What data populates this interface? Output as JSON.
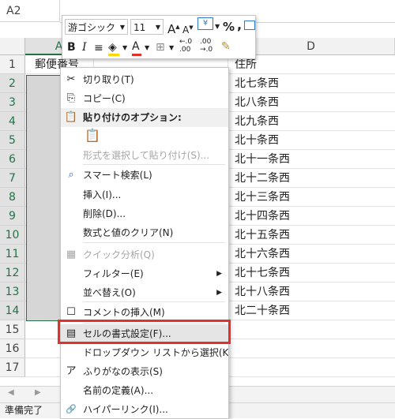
{
  "name_box": "A2",
  "columns": {
    "a": "A",
    "d": "D"
  },
  "rows": [
    "1",
    "2",
    "3",
    "4",
    "5",
    "6",
    "7",
    "8",
    "9",
    "10",
    "11",
    "12",
    "13",
    "14",
    "15",
    "16",
    "17"
  ],
  "header_row": {
    "a1": "郵便番号",
    "c1": "住所"
  },
  "addresses": [
    "北七条西",
    "北八条西",
    "北九条西",
    "北十条西",
    "北十一条西",
    "北十二条西",
    "北十三条西",
    "北十四条西",
    "北十五条西",
    "北十六条西",
    "北十七条西",
    "北十八条西",
    "北二十条西"
  ],
  "mini_toolbar": {
    "font_name": "游ゴシック",
    "font_size": "11",
    "grow_font": "A",
    "shrink_font": "A",
    "currency": "¥",
    "percent": "%",
    "comma": ",",
    "bold": "B",
    "italic": "I",
    "font_color_letter": "A",
    "increase_decimal": ".00",
    "decrease_decimal": ".0",
    "colors": {
      "fill": "#ffd800",
      "font": "#e0312a"
    }
  },
  "context_menu": [
    {
      "label": "切り取り(T)",
      "icon": "scissors-icon",
      "disabled": false
    },
    {
      "label": "コピー(C)",
      "icon": "copy-icon",
      "disabled": false
    },
    {
      "label": "貼り付けのオプション:",
      "icon": "paste-icon",
      "disabled": false,
      "header": true
    },
    {
      "label": "形式を選択して貼り付け(S)...",
      "icon": "",
      "disabled": true
    },
    {
      "label": "スマート検索(L)",
      "icon": "smart-lookup-icon",
      "disabled": false
    },
    {
      "label": "挿入(I)...",
      "icon": "",
      "disabled": false
    },
    {
      "label": "削除(D)...",
      "icon": "",
      "disabled": false
    },
    {
      "label": "数式と値のクリア(N)",
      "icon": "",
      "disabled": false
    },
    {
      "label": "クイック分析(Q)",
      "icon": "quick-analysis-icon",
      "disabled": true
    },
    {
      "label": "フィルター(E)",
      "icon": "",
      "disabled": false,
      "submenu": true
    },
    {
      "label": "並べ替え(O)",
      "icon": "",
      "disabled": false,
      "submenu": true
    },
    {
      "label": "コメントの挿入(M)",
      "icon": "comment-icon",
      "disabled": false
    },
    {
      "label": "セルの書式設定(F)...",
      "icon": "format-cells-icon",
      "disabled": false,
      "highlighted": true
    },
    {
      "label": "ドロップダウン リストから選択(K)...",
      "icon": "",
      "disabled": false
    },
    {
      "label": "ふりがなの表示(S)",
      "icon": "furigana-icon",
      "disabled": false
    },
    {
      "label": "名前の定義(A)...",
      "icon": "",
      "disabled": false
    },
    {
      "label": "ハイパーリンク(I)...",
      "icon": "hyperlink-icon",
      "disabled": false
    }
  ],
  "status_bar": {
    "text": "準備完了"
  },
  "accent": "#217346",
  "highlight_outline": "#e0312a"
}
